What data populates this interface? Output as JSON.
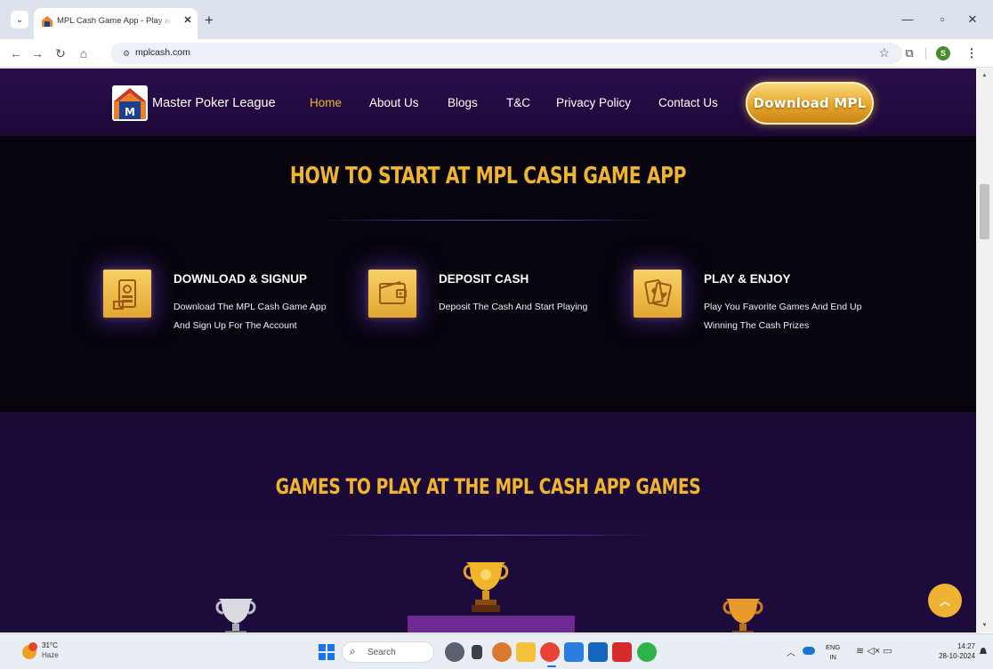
{
  "browser": {
    "tab_title": "MPL Cash Game App - Play and Win",
    "tab_close": "✕",
    "new_tab": "+",
    "url": "mplcash.com"
  },
  "site": {
    "brand_name": "Master Poker League",
    "nav": [
      {
        "label": "Home",
        "active": true
      },
      {
        "label": "About Us",
        "active": false
      },
      {
        "label": "Blogs",
        "active": false
      },
      {
        "label": "T&C",
        "active": false
      },
      {
        "label": "Privacy Policy",
        "active": false
      },
      {
        "label": "Contact Us",
        "active": false
      }
    ],
    "download_button": "Download MPL"
  },
  "start_section": {
    "title": "HOW TO START AT MPL CASH GAME APP",
    "steps": [
      {
        "icon": "phone-signup-icon",
        "heading": "DOWNLOAD & SIGNUP",
        "description": "Download The MPL Cash Game App And Sign Up For The Account"
      },
      {
        "icon": "wallet-icon",
        "heading": "DEPOSIT CASH",
        "description": "Deposit The Cash And Start Playing"
      },
      {
        "icon": "playing-cards-icon",
        "heading": "PLAY & ENJOY",
        "description": "Play You Favorite Games And End Up Winning The Cash Prizes"
      }
    ]
  },
  "games_section": {
    "title": "GAMES TO PLAY AT THE MPL CASH APP GAMES"
  },
  "taskbar": {
    "weather_temp": "31°C",
    "weather_desc": "Haze",
    "search_placeholder": "Search",
    "lang_top": "ENG",
    "lang_bottom": "IN",
    "time": "14:27",
    "date": "28-10-2024"
  },
  "colors": {
    "accent_gold": "#f0b52e",
    "header_purple": "#2a0e4c",
    "section_dark": "#07040d",
    "section_purple": "#1a0a36",
    "podium": "#6d2b91"
  }
}
